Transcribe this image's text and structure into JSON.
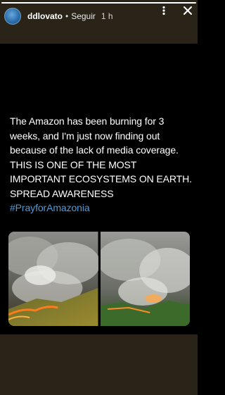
{
  "story": {
    "progress": 1.0
  },
  "header": {
    "username": "ddlovato",
    "separator": "•",
    "follow_label": "Seguir",
    "time": "1 h",
    "avatar_icon": "avatar-icon",
    "more_icon": "three-dots-icon",
    "close_icon": "close-icon"
  },
  "tweet": {
    "text": "The Amazon has been burning for 3 weeks, and I'm just now finding out because of the lack of media coverage. THIS IS ONE OF THE MOST IMPORTANT ECOSYSTEMS ON EARTH. SPREAD AWARENESS",
    "hashtag": "#PrayforAmazonia",
    "hashtag_color": "#4f9bd9"
  },
  "colors": {
    "background": "#2a2418",
    "card": "#000000"
  }
}
